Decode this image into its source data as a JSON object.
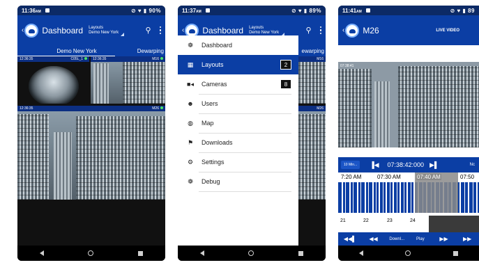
{
  "phones": [
    {
      "status": {
        "time": "11:36",
        "ampm": "AM",
        "right": "⊘ ♥ ▮ 90%"
      },
      "appbar": {
        "title": "Dashboard",
        "sub1": "Layouts",
        "sub2": "Demo New York"
      },
      "tabs": [
        "Demo New York",
        "Dewarping"
      ],
      "cams": [
        {
          "time": "12:36:35",
          "name": "C05L_1"
        },
        {
          "time": "12:36:35",
          "name": "M16"
        },
        {
          "time": "12:36:35",
          "name": "M26"
        }
      ]
    },
    {
      "status": {
        "time": "11:37",
        "ampm": "AM",
        "right": "⊘ ♥ ▮ 89%"
      },
      "appbar": {
        "title": "Dashboard",
        "sub1": "Layouts",
        "sub2": "Demo New York"
      },
      "tab_partial": "ewarping",
      "cams": [
        {
          "name": "M16"
        },
        {
          "name": "M26"
        }
      ],
      "drawer": [
        {
          "icon": "dashboard-icon",
          "glyph": "❁",
          "label": "Dashboard"
        },
        {
          "icon": "layouts-icon",
          "glyph": "▦",
          "label": "Layouts",
          "badge": "2",
          "active": true
        },
        {
          "icon": "camera-icon",
          "glyph": "■◂",
          "label": "Cameras",
          "badge": "8"
        },
        {
          "icon": "users-icon",
          "glyph": "☻",
          "label": "Users"
        },
        {
          "icon": "globe-icon",
          "glyph": "◍",
          "label": "Map"
        },
        {
          "icon": "flag-icon",
          "glyph": "⚑",
          "label": "Downloads"
        },
        {
          "icon": "gear-icon",
          "glyph": "⚙",
          "label": "Settings"
        },
        {
          "icon": "debug-icon",
          "glyph": "❁",
          "label": "Debug"
        }
      ]
    },
    {
      "status": {
        "time": "11:41",
        "ampm": "AM",
        "right": "⊘ ♥ ▮ 89"
      },
      "appbar": {
        "title": "M26",
        "live": "LIVE VIDEO"
      },
      "video_time": "07:38:41",
      "controls": {
        "range": "10 Min...",
        "timecode": "07:38:42:000",
        "next": "Nc"
      },
      "timeline_labels": [
        "7:20 AM",
        "07:30 AM",
        "07:40 AM",
        "07:50"
      ],
      "days": [
        "21",
        "22",
        "23",
        "24"
      ],
      "playbar": {
        "download": "Downl...",
        "play": "Play"
      }
    }
  ]
}
